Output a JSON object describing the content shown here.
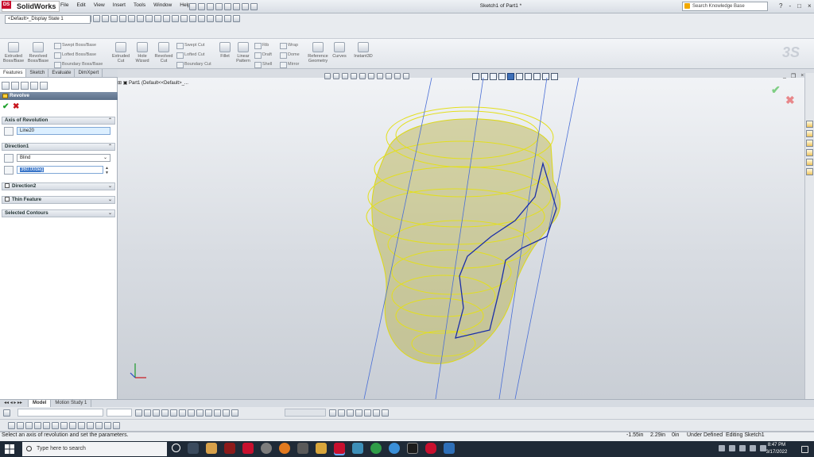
{
  "app": {
    "name": "SolidWorks",
    "doc_title": "Sketch1 of Part1 *"
  },
  "menu": [
    "File",
    "Edit",
    "View",
    "Insert",
    "Tools",
    "Window",
    "Help"
  ],
  "search": {
    "placeholder": "Search Knowledge Base"
  },
  "window_controls": [
    "?",
    "-",
    "□",
    "×"
  ],
  "config": {
    "selected": "<Default>_Display State 1"
  },
  "command_manager": {
    "big": [
      {
        "name": "extruded-boss-button",
        "label": "Extruded Boss/Base"
      },
      {
        "name": "revolved-boss-button",
        "label": "Revolved Boss/Base"
      },
      {
        "name": "extruded-cut-button",
        "label": "Extruded Cut"
      },
      {
        "name": "hole-wizard-button",
        "label": "Hole Wizard"
      },
      {
        "name": "revolved-cut-button",
        "label": "Revolved Cut"
      },
      {
        "name": "fillet-button",
        "label": "Fillet"
      },
      {
        "name": "linear-pattern-button",
        "label": "Linear Pattern"
      },
      {
        "name": "reference-geometry-button",
        "label": "Reference Geometry"
      },
      {
        "name": "curves-button",
        "label": "Curves"
      },
      {
        "name": "instant3d-button",
        "label": "Instant3D"
      }
    ],
    "small": {
      "swept_boss": "Swept Boss/Base",
      "lofted_boss": "Lofted Boss/Base",
      "boundary_boss": "Boundary Boss/Base",
      "swept_cut": "Swept Cut",
      "lofted_cut": "Lofted Cut",
      "boundary_cut": "Boundary Cut",
      "rib": "Rib",
      "draft": "Draft",
      "shell": "Shell",
      "wrap": "Wrap",
      "dome": "Dome",
      "mirror": "Mirror"
    }
  },
  "tabs": [
    "Features",
    "Sketch",
    "Evaluate",
    "DimXpert"
  ],
  "property_manager": {
    "title": "Revolve",
    "ok": "✔",
    "cancel": "✖",
    "axis_group": "Axis of Revolution",
    "axis_value": "Line20",
    "direction1_group": "Direction1",
    "end_condition": "Blind",
    "angle_value": "360.00deg",
    "direction2_group": "Direction2",
    "thin_feature_group": "Thin Feature",
    "selected_contours_group": "Selected Contours"
  },
  "feature_tree": {
    "root": "Part1 (Default<<Default>_..."
  },
  "bottom_tabs": [
    "Model",
    "Motion Study 1"
  ],
  "status": {
    "message": "Select an axis of revolution and set the parameters.",
    "x": "-1.55in",
    "y": "2.29in",
    "z": "0in",
    "definition": "Under Defined",
    "editing": "Editing Sketch1"
  },
  "taskbar": {
    "search_placeholder": "Type here to search",
    "time": "8:47 PM",
    "date": "3/17/2022"
  },
  "colors": {
    "accent": "#3a76c9",
    "edge": "#d9d51a",
    "sketch": "#1a2ea8",
    "taskbar": "#1f2a37"
  }
}
